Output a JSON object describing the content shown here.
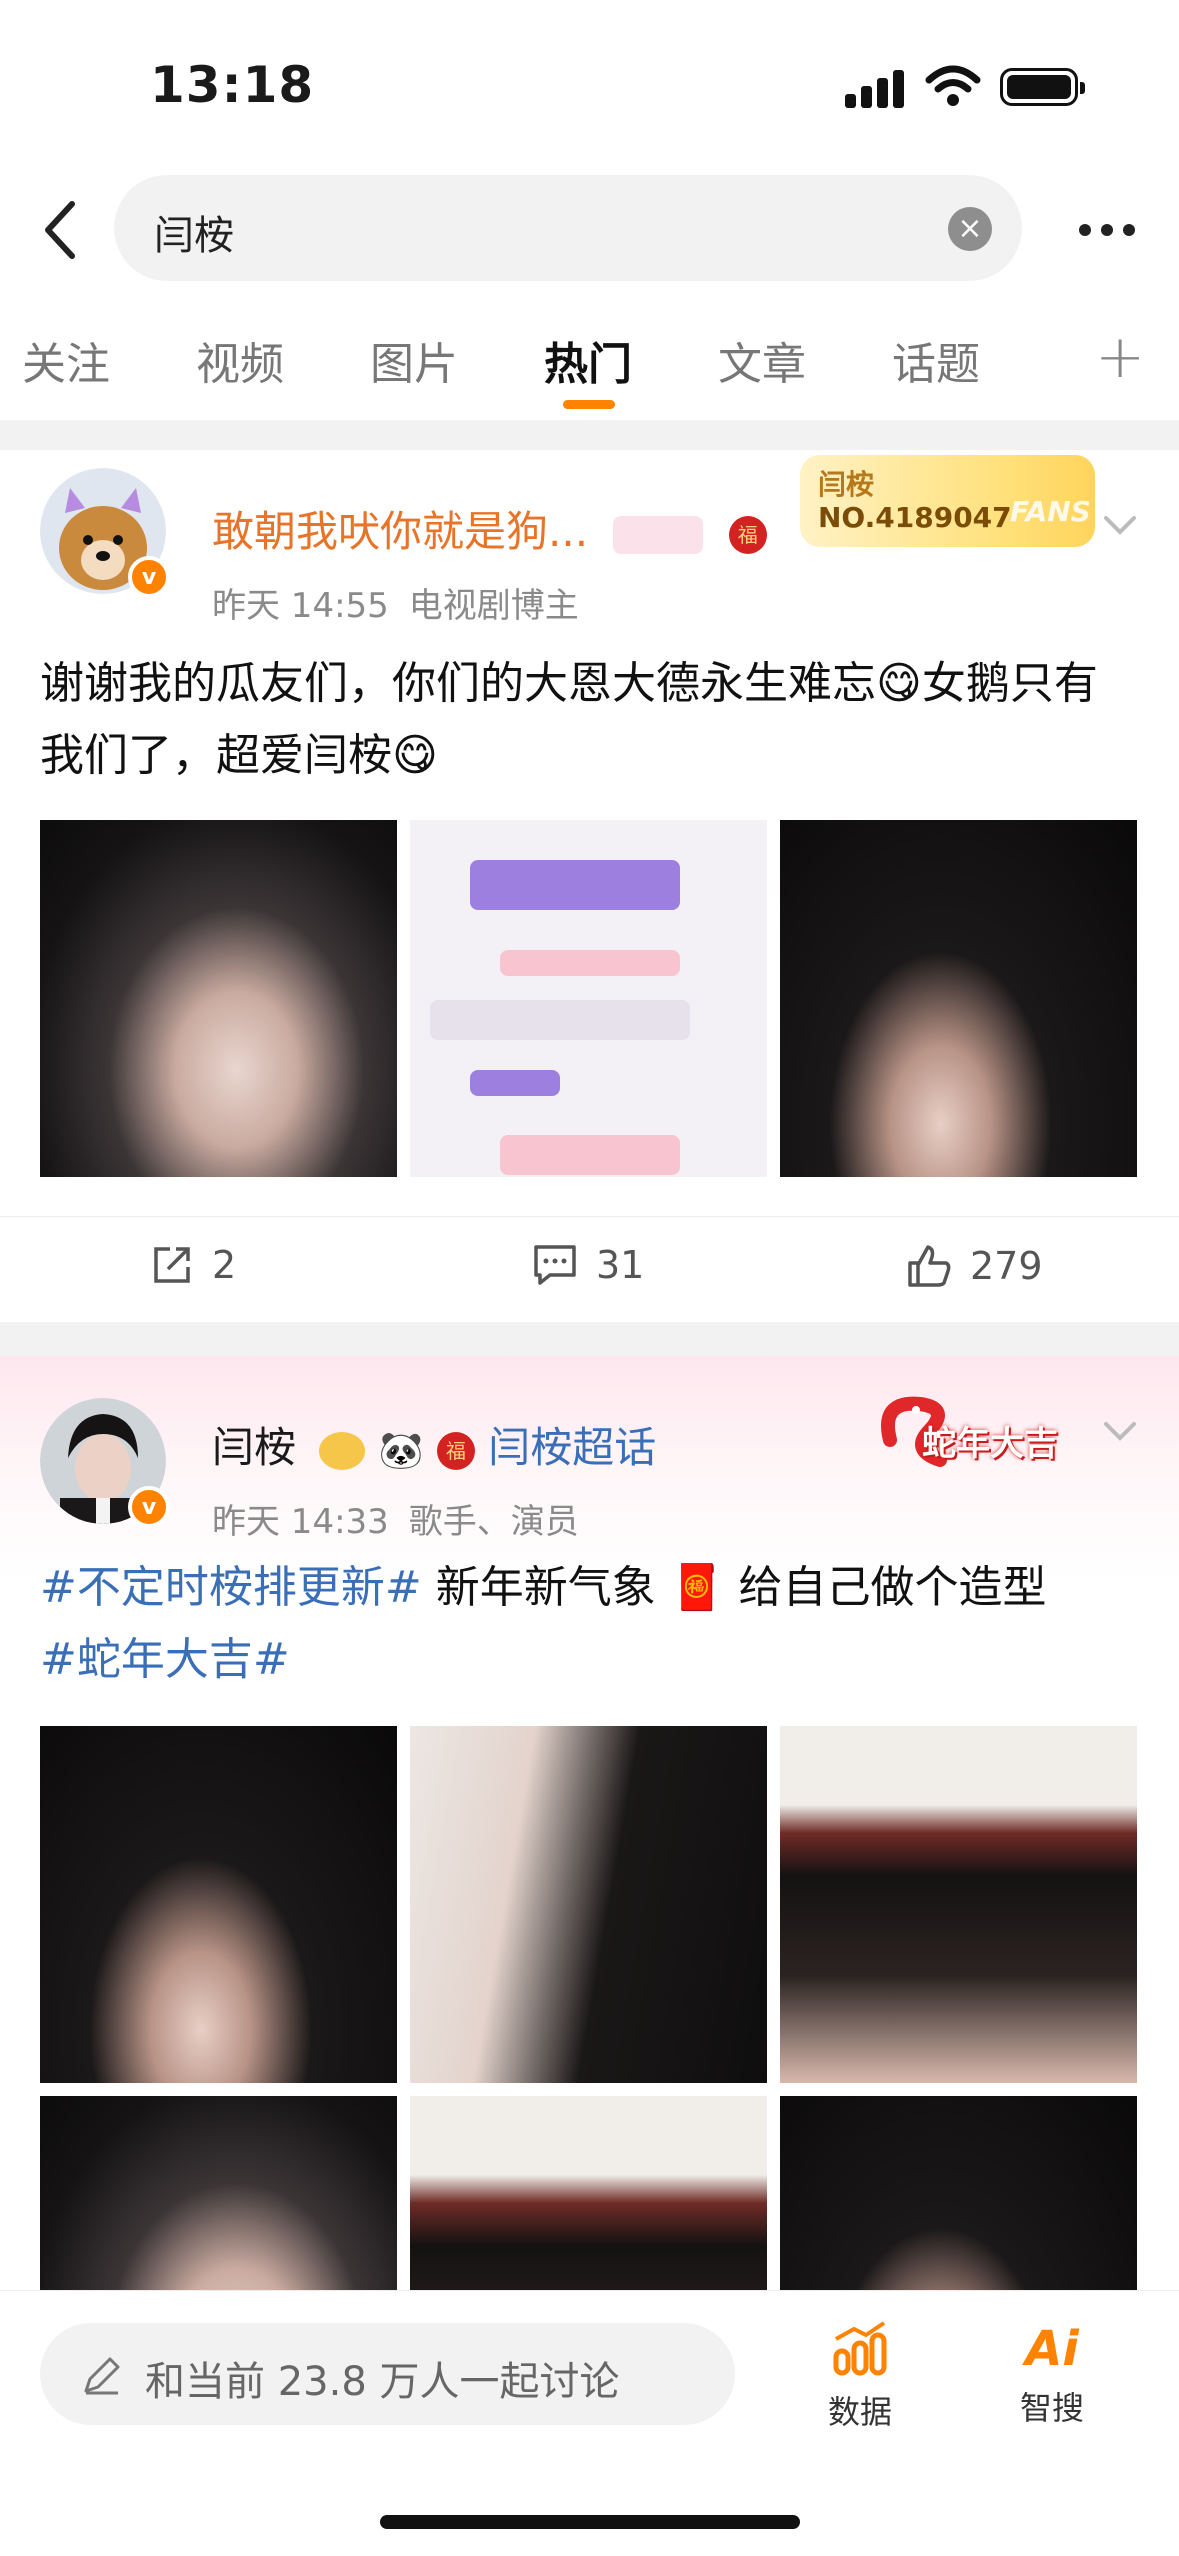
{
  "status": {
    "time": "13:18"
  },
  "search": {
    "query": "闫桉"
  },
  "tabs": [
    {
      "label": "关注"
    },
    {
      "label": "视频"
    },
    {
      "label": "图片"
    },
    {
      "label": "热门"
    },
    {
      "label": "文章"
    },
    {
      "label": "话题"
    }
  ],
  "active_tab_index": 3,
  "posts": [
    {
      "username": "敢朝我吠你就是狗...",
      "time": "昨天 14:55",
      "source": "电视剧博主",
      "text": "谢谢我的瓜友们，你们的大恩大德永生难忘😋女鹅只有我们了，超爱闫桉😋",
      "fans_badge": {
        "name": "闫桉",
        "number": "NO.4189047",
        "label": "FANS"
      },
      "images": [
        "photo",
        "chat-screenshot",
        "photo"
      ],
      "actions": {
        "share": "2",
        "comments": "31",
        "likes": "279"
      }
    },
    {
      "username": "闫桉",
      "supertopic": "闫桉超话",
      "time": "昨天 14:33",
      "source": "歌手、演员",
      "topic1": "#不定时桉排更新#",
      "text_middle": " 新年新气象 🧧 给自己做个造型",
      "topic2": "#蛇年大吉#",
      "festive_badge": "蛇年大吉",
      "images": [
        "photo",
        "photo",
        "photo",
        "photo",
        "photo",
        "photo"
      ]
    }
  ],
  "bottom": {
    "discuss_prompt": "和当前 23.8 万人一起讨论",
    "data_label": "数据",
    "ai_label": "智搜",
    "ai_icon_text": "Ai"
  },
  "colors": {
    "accent": "#ff8200",
    "topic": "#3a6fb8",
    "username_orange": "#e8742a"
  }
}
